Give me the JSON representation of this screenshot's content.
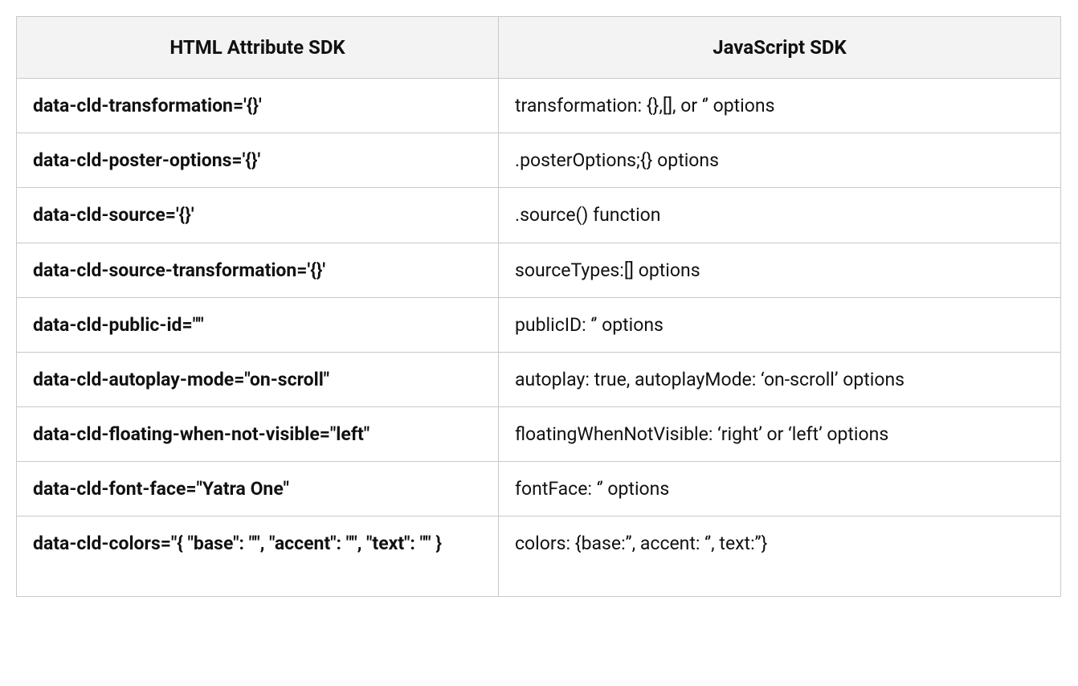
{
  "table": {
    "headers": {
      "left": "HTML Attribute SDK",
      "right": "JavaScript SDK"
    },
    "rows": [
      {
        "attr": "data-cld-transformation='{}'",
        "js": "transformation: {},[], or ‘’  options"
      },
      {
        "attr": "data-cld-poster-options='{}'",
        "js": ".posterOptions;{}  options"
      },
      {
        "attr": "data-cld-source='{}'",
        "js": ".source()  function"
      },
      {
        "attr": "data-cld-source-transformation='{}'",
        "js": "sourceTypes:[]  options"
      },
      {
        "attr": "data-cld-public-id=\"\"",
        "js": "publicID: ‘’ options"
      },
      {
        "attr": "data-cld-autoplay-mode=\"on-scroll\"",
        "js": "autoplay: true, autoplayMode: ‘on-scroll’ options"
      },
      {
        "attr": "data-cld-floating-when-not-visible=\"left\"",
        "js": "floatingWhenNotVisible: ‘right’ or ‘left’ options"
      },
      {
        "attr": "data-cld-font-face=\"Yatra One\"",
        "js": "fontFace: ‘’ options"
      },
      {
        "attr": "data-cld-colors=\"{ \"base\": \"\", \"accent\": \"\", \"text\": \"\" }",
        "js": "colors: {base:’’, accent: ‘’, text:’’}"
      }
    ]
  }
}
